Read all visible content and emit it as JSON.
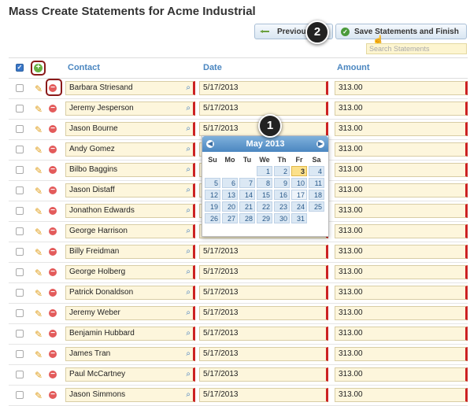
{
  "page": {
    "title": "Mass Create Statements for Acme Industrial"
  },
  "toolbar": {
    "prev_label": "Previous",
    "save_label": "Save Statements and Finish",
    "search_placeholder": "Search Statements"
  },
  "callouts": {
    "one": "1",
    "two": "2"
  },
  "columns": {
    "contact": "Contact",
    "date": "Date",
    "amount": "Amount"
  },
  "rows": [
    {
      "contact": "Barbara Striesand",
      "date": "5/17/2013",
      "amount": "313.00"
    },
    {
      "contact": "Jeremy Jesperson",
      "date": "5/17/2013",
      "amount": "313.00"
    },
    {
      "contact": "Jason Bourne",
      "date": "5/17/2013",
      "amount": "313.00"
    },
    {
      "contact": "Andy Gomez",
      "date": "",
      "amount": "313.00"
    },
    {
      "contact": "Bilbo Baggins",
      "date": "",
      "amount": "313.00"
    },
    {
      "contact": "Jason Distaff",
      "date": "",
      "amount": "313.00"
    },
    {
      "contact": "Jonathon Edwards",
      "date": "",
      "amount": "313.00"
    },
    {
      "contact": "George Harrison",
      "date": "",
      "amount": "313.00"
    },
    {
      "contact": "Billy Freidman",
      "date": "5/17/2013",
      "amount": "313.00"
    },
    {
      "contact": "George Holberg",
      "date": "5/17/2013",
      "amount": "313.00"
    },
    {
      "contact": "Patrick Donaldson",
      "date": "5/17/2013",
      "amount": "313.00"
    },
    {
      "contact": "Jeremy Weber",
      "date": "5/17/2013",
      "amount": "313.00"
    },
    {
      "contact": "Benjamin Hubbard",
      "date": "5/17/2013",
      "amount": "313.00"
    },
    {
      "contact": "James Tran",
      "date": "5/17/2013",
      "amount": "313.00"
    },
    {
      "contact": "Paul McCartney",
      "date": "5/17/2013",
      "amount": "313.00"
    },
    {
      "contact": "Jason Simmons",
      "date": "5/17/2013",
      "amount": "313.00"
    }
  ],
  "calendar": {
    "month_label": "May 2013",
    "days_of_week": [
      "Su",
      "Mo",
      "Tu",
      "We",
      "Th",
      "Fr",
      "Sa"
    ],
    "days": [
      "",
      "",
      "",
      "1",
      "2",
      "3",
      "4",
      "5",
      "6",
      "7",
      "8",
      "9",
      "10",
      "11",
      "12",
      "13",
      "14",
      "15",
      "16",
      "17",
      "18",
      "19",
      "20",
      "21",
      "22",
      "23",
      "24",
      "25",
      "26",
      "27",
      "28",
      "29",
      "30",
      "31",
      ""
    ],
    "highlighted_day": "3",
    "selected_day": "17"
  },
  "icons": {
    "prev": "arrow-left-icon",
    "save": "check-circle-icon",
    "edit": "pencil-icon",
    "remove": "minus-circle-icon",
    "add": "plus-circle-icon",
    "lookup": "magnifier-icon"
  },
  "colors": {
    "header_text": "#4a86c0",
    "required_marker": "#cc2222",
    "field_bg": "#fdf6dc",
    "calendar_header": "#4b86c0"
  }
}
